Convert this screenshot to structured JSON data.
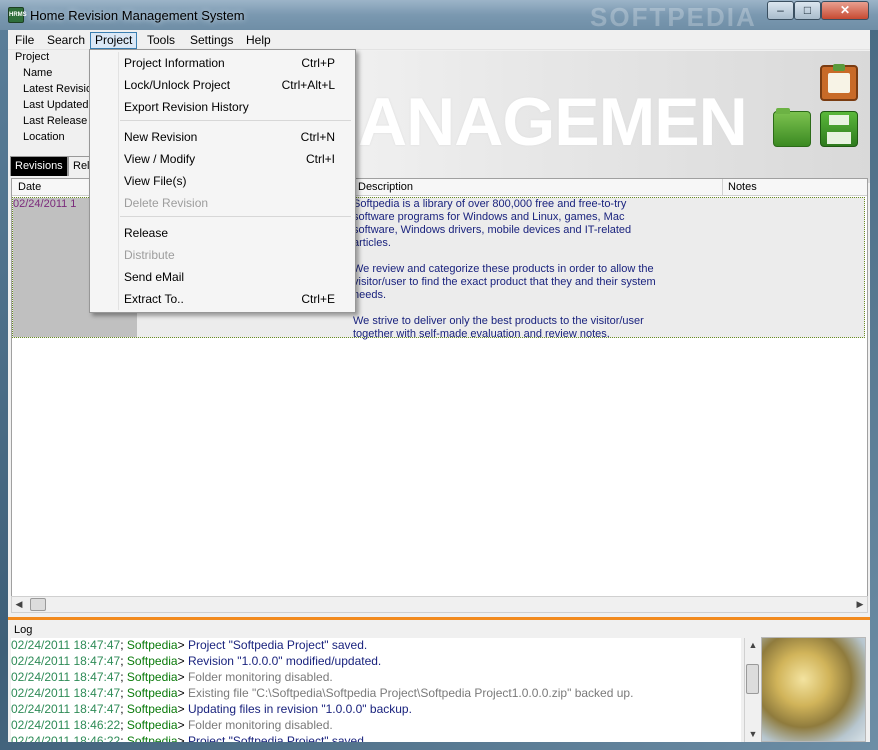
{
  "window": {
    "title": "Home Revision Management System",
    "app_icon_text": "HRMS",
    "watermark": "SOFTPEDIA",
    "controls": {
      "minimize": "–",
      "maximize": "□",
      "close": "✕"
    }
  },
  "menubar": {
    "items": [
      "File",
      "Search",
      "Project",
      "Tools",
      "Settings",
      "Help"
    ],
    "active": "Project"
  },
  "project_info": {
    "heading": "Project",
    "fields": [
      "Name",
      "Latest Revisio",
      "Last Updated",
      "Last Release",
      "Location"
    ]
  },
  "banner": {
    "text": "ANAGEMEN"
  },
  "toolbar_icons": [
    "clipboard-icon",
    "folder-icon",
    "save-icon"
  ],
  "tabs": {
    "items": [
      "Revisions",
      "Rele"
    ],
    "active": "Revisions"
  },
  "grid": {
    "columns": [
      "Date",
      "Description",
      "Notes"
    ],
    "rows": [
      {
        "date": "02/24/2011 1",
        "description": "Softpedia is a library of over 800,000 free and free-to-try\nsoftware programs for Windows and Linux, games, Mac\nsoftware, Windows drivers, mobile devices and IT-related\narticles.\n\nWe review and categorize these products in order to allow the\nvisitor/user to find the exact product that they and their system\nneeds.\n\nWe strive to deliver only the best products to the visitor/user\ntogether with self-made evaluation and review notes.",
        "notes": ""
      }
    ]
  },
  "project_menu": {
    "items": [
      {
        "label": "Project Information",
        "shortcut": "Ctrl+P",
        "enabled": true
      },
      {
        "label": "Lock/Unlock Project",
        "shortcut": "Ctrl+Alt+L",
        "enabled": true
      },
      {
        "label": "Export Revision History",
        "shortcut": "",
        "enabled": true
      },
      {
        "label": "New Revision",
        "shortcut": "Ctrl+N",
        "enabled": true
      },
      {
        "label": "View / Modify",
        "shortcut": "Ctrl+I",
        "enabled": true
      },
      {
        "label": "View File(s)",
        "shortcut": "",
        "enabled": true
      },
      {
        "label": "Delete Revision",
        "shortcut": "",
        "enabled": false
      },
      {
        "label": "Release",
        "shortcut": "",
        "enabled": true
      },
      {
        "label": "Distribute",
        "shortcut": "",
        "enabled": false
      },
      {
        "label": "Send eMail",
        "shortcut": "",
        "enabled": true
      },
      {
        "label": "Extract To..",
        "shortcut": "Ctrl+E",
        "enabled": true
      }
    ]
  },
  "log": {
    "title": "Log",
    "entries": [
      {
        "ts": "02/24/2011 18:47:47",
        "user": "Softpedia",
        "msg": "Project \"Softpedia Project\" saved.",
        "gray": false
      },
      {
        "ts": "02/24/2011 18:47:47",
        "user": "Softpedia",
        "msg": "Revision \"1.0.0.0\" modified/updated.",
        "gray": false
      },
      {
        "ts": "02/24/2011 18:47:47",
        "user": "Softpedia",
        "msg": "Folder monitoring disabled.",
        "gray": true
      },
      {
        "ts": "02/24/2011 18:47:47",
        "user": "Softpedia",
        "msg": "Existing file \"C:\\Softpedia\\Softpedia Project\\Softpedia Project1.0.0.0.zip\" backed up.",
        "gray": true
      },
      {
        "ts": "02/24/2011 18:47:47",
        "user": "Softpedia",
        "msg": "Updating files in revision \"1.0.0.0\" backup.",
        "gray": false
      },
      {
        "ts": "02/24/2011 18:46:22",
        "user": "Softpedia",
        "msg": "Folder monitoring disabled.",
        "gray": true
      },
      {
        "ts": "02/24/2011 18:46:22",
        "user": "Softpedia",
        "msg": "Project \"Softpedia Project\" saved.",
        "gray": false
      }
    ]
  }
}
